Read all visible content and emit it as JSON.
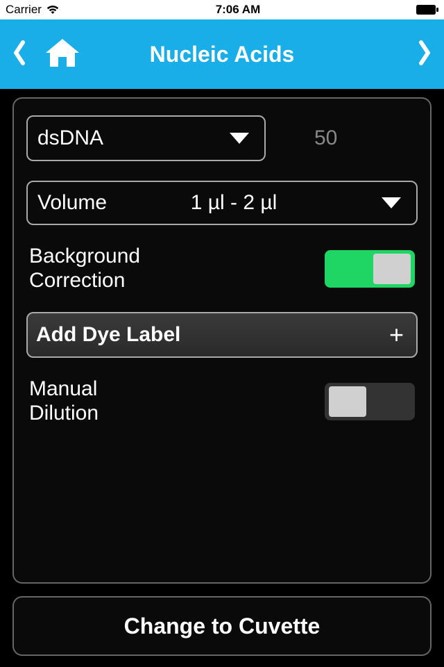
{
  "status": {
    "carrier": "Carrier",
    "time": "7:06 AM"
  },
  "nav": {
    "title": "Nucleic Acids"
  },
  "panel": {
    "sample_type": "dsDNA",
    "sample_coeff": "50",
    "volume_label": "Volume",
    "volume_value": "1 µl - 2 µl",
    "background_label": "Background\nCorrection",
    "background_on": true,
    "add_dye_label": "Add Dye Label",
    "manual_label": "Manual\nDilution",
    "manual_on": false
  },
  "bottom": {
    "label": "Change to Cuvette"
  }
}
